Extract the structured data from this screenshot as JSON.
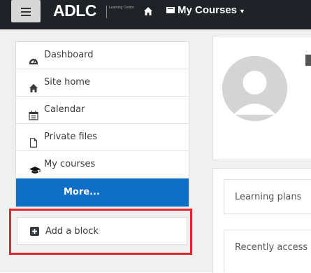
{
  "navbar": {
    "brand": "ADLC",
    "brand_sub": "Learning Centre",
    "courses_menu": "My Courses"
  },
  "sidebar": {
    "items": [
      {
        "label": "Dashboard",
        "icon": "dashboard-icon"
      },
      {
        "label": "Site home",
        "icon": "home-icon"
      },
      {
        "label": "Calendar",
        "icon": "calendar-icon"
      },
      {
        "label": "Private files",
        "icon": "file-icon"
      },
      {
        "label": "My courses",
        "icon": "graduation-cap-icon"
      }
    ],
    "more_label": "More..."
  },
  "add_block": {
    "label": "Add a block",
    "icon": "plus-square-icon"
  },
  "content": {
    "learning_plans": "Learning plans",
    "recently_accessed": "Recently access"
  },
  "colors": {
    "navbar": "#1f2226",
    "accent": "#0f6fc6",
    "highlight": "#e0252e"
  }
}
